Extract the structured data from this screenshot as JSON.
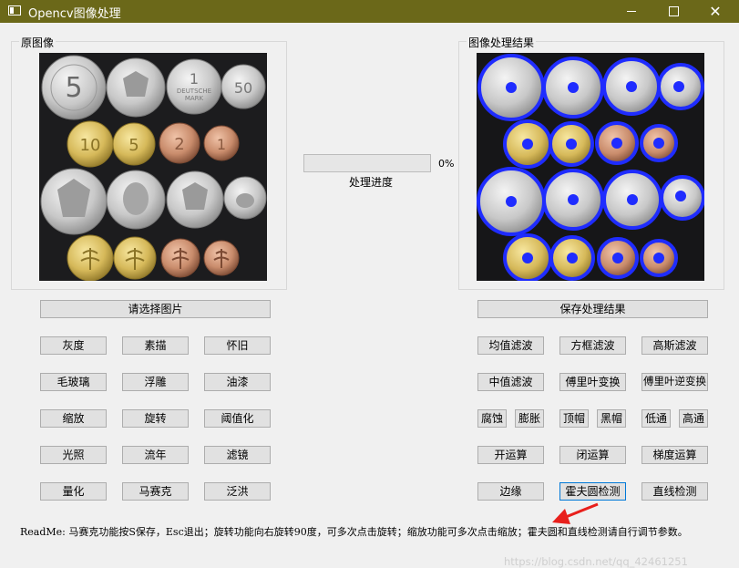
{
  "window": {
    "title": "Opencv图像处理",
    "minimize": "–",
    "close": "✕"
  },
  "groups": {
    "original": "原图像",
    "result": "图像处理结果"
  },
  "progress": {
    "percent": "0%",
    "value": 0,
    "label": "处理进度"
  },
  "buttons": {
    "select_image": "请选择图片",
    "save_result": "保存处理结果",
    "gray": "灰度",
    "sketch": "素描",
    "nostalgia": "怀旧",
    "frosted": "毛玻璃",
    "emboss": "浮雕",
    "oil": "油漆",
    "zoom": "缩放",
    "rotate": "旋转",
    "threshold": "阈值化",
    "light": "光照",
    "fleeting": "流年",
    "filter": "滤镜",
    "quantize": "量化",
    "mosaic": "马赛克",
    "flood": "泛洪",
    "mean_filter": "均值滤波",
    "box_filter": "方框滤波",
    "gauss_filter": "高斯滤波",
    "median_filter": "中值滤波",
    "fourier": "傅里叶变换",
    "inv_fourier": "傅里叶逆变换",
    "erode": "腐蚀",
    "dilate": "膨胀",
    "tophat": "顶帽",
    "blackhat": "黑帽",
    "lowpass": "低通",
    "highpass": "高通",
    "open_op": "开运算",
    "close_op": "闭运算",
    "gradient_op": "梯度运算",
    "edge": "边缘",
    "hough_circle": "霍夫圆检测",
    "hough_line": "直线检测"
  },
  "coin_labels": {
    "c1": "5",
    "c3": "1",
    "c3b": "DEUTSCHE",
    "c3c": "MARK",
    "c4": "50",
    "c5": "10",
    "c6": "5",
    "c7": "2",
    "c8": "1"
  },
  "readme": "ReadMe: 马赛克功能按S保存，Esc退出；旋转功能向右旋转90度，可多次点击旋转；缩放功能可多次点击缩放；霍夫圆和直线检测请自行调节参数。",
  "watermark": "https://blog.csdn.net/qq_42461251",
  "colors": {
    "titlebar": "#6b6819",
    "detect_circle": "#1f2cff",
    "progress_fill": "#06b025"
  }
}
